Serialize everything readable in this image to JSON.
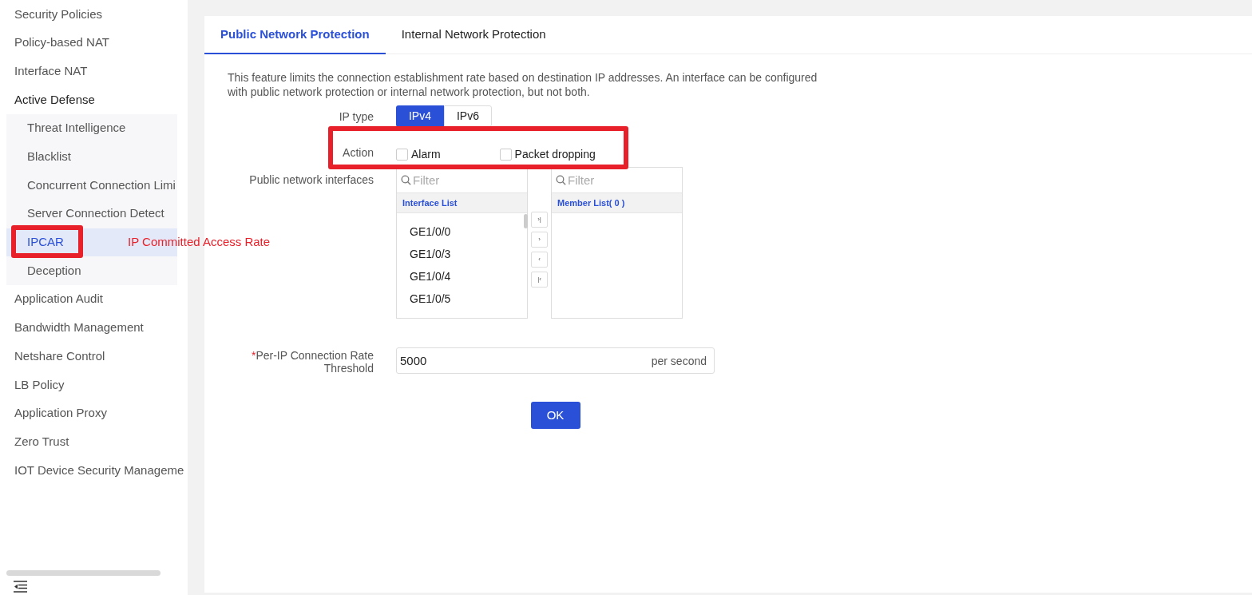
{
  "sidebar": {
    "items": [
      {
        "label": "Security Policies",
        "selected": false
      },
      {
        "label": "Policy-based NAT",
        "selected": false
      },
      {
        "label": "Interface NAT",
        "selected": false
      },
      {
        "label": "Active Defense",
        "selected": false,
        "expanded": true,
        "children": [
          {
            "label": "Threat Intelligence",
            "selected": false
          },
          {
            "label": "Blacklist",
            "selected": false
          },
          {
            "label": "Concurrent Connection Limi",
            "selected": false
          },
          {
            "label": "Server Connection Detect",
            "selected": false
          },
          {
            "label": "IPCAR",
            "selected": true
          },
          {
            "label": "Deception",
            "selected": false
          }
        ]
      },
      {
        "label": "Application Audit",
        "selected": false
      },
      {
        "label": "Bandwidth Management",
        "selected": false
      },
      {
        "label": "Netshare Control",
        "selected": false
      },
      {
        "label": "LB Policy",
        "selected": false
      },
      {
        "label": "Application Proxy",
        "selected": false
      },
      {
        "label": "Zero Trust",
        "selected": false
      },
      {
        "label": "IOT Device Security Manageme",
        "selected": false
      }
    ]
  },
  "annotation": {
    "label": "IP Committed Access Rate"
  },
  "tabs": [
    {
      "label": "Public Network Protection",
      "selected": true
    },
    {
      "label": "Internal Network Protection",
      "selected": false
    }
  ],
  "description": "This feature limits the connection establishment rate based on destination IP addresses. An interface can be configured with public network protection or internal network protection, but not both.",
  "ip_type": {
    "label": "IP type",
    "options": [
      {
        "label": "IPv4",
        "selected": true
      },
      {
        "label": "IPv6",
        "selected": false
      }
    ]
  },
  "action": {
    "label": "Action",
    "options": [
      {
        "label": "Alarm",
        "checked": false
      },
      {
        "label": "Packet dropping",
        "checked": false
      }
    ]
  },
  "interfaces": {
    "label": "Public network interfaces",
    "left": {
      "placeholder": "Filter",
      "header": "Interface List",
      "items": [
        "GE1/0/0",
        "GE1/0/3",
        "GE1/0/4",
        "GE1/0/5"
      ]
    },
    "transfer_buttons": [
      "›|",
      "›",
      "‹",
      "|‹"
    ],
    "right": {
      "placeholder": "Filter",
      "header": "Member List( 0 )"
    }
  },
  "threshold": {
    "required_mark": "*",
    "label": "Per-IP Connection Rate Threshold",
    "value": "5000",
    "unit": "per second"
  },
  "ok_button": "OK"
}
